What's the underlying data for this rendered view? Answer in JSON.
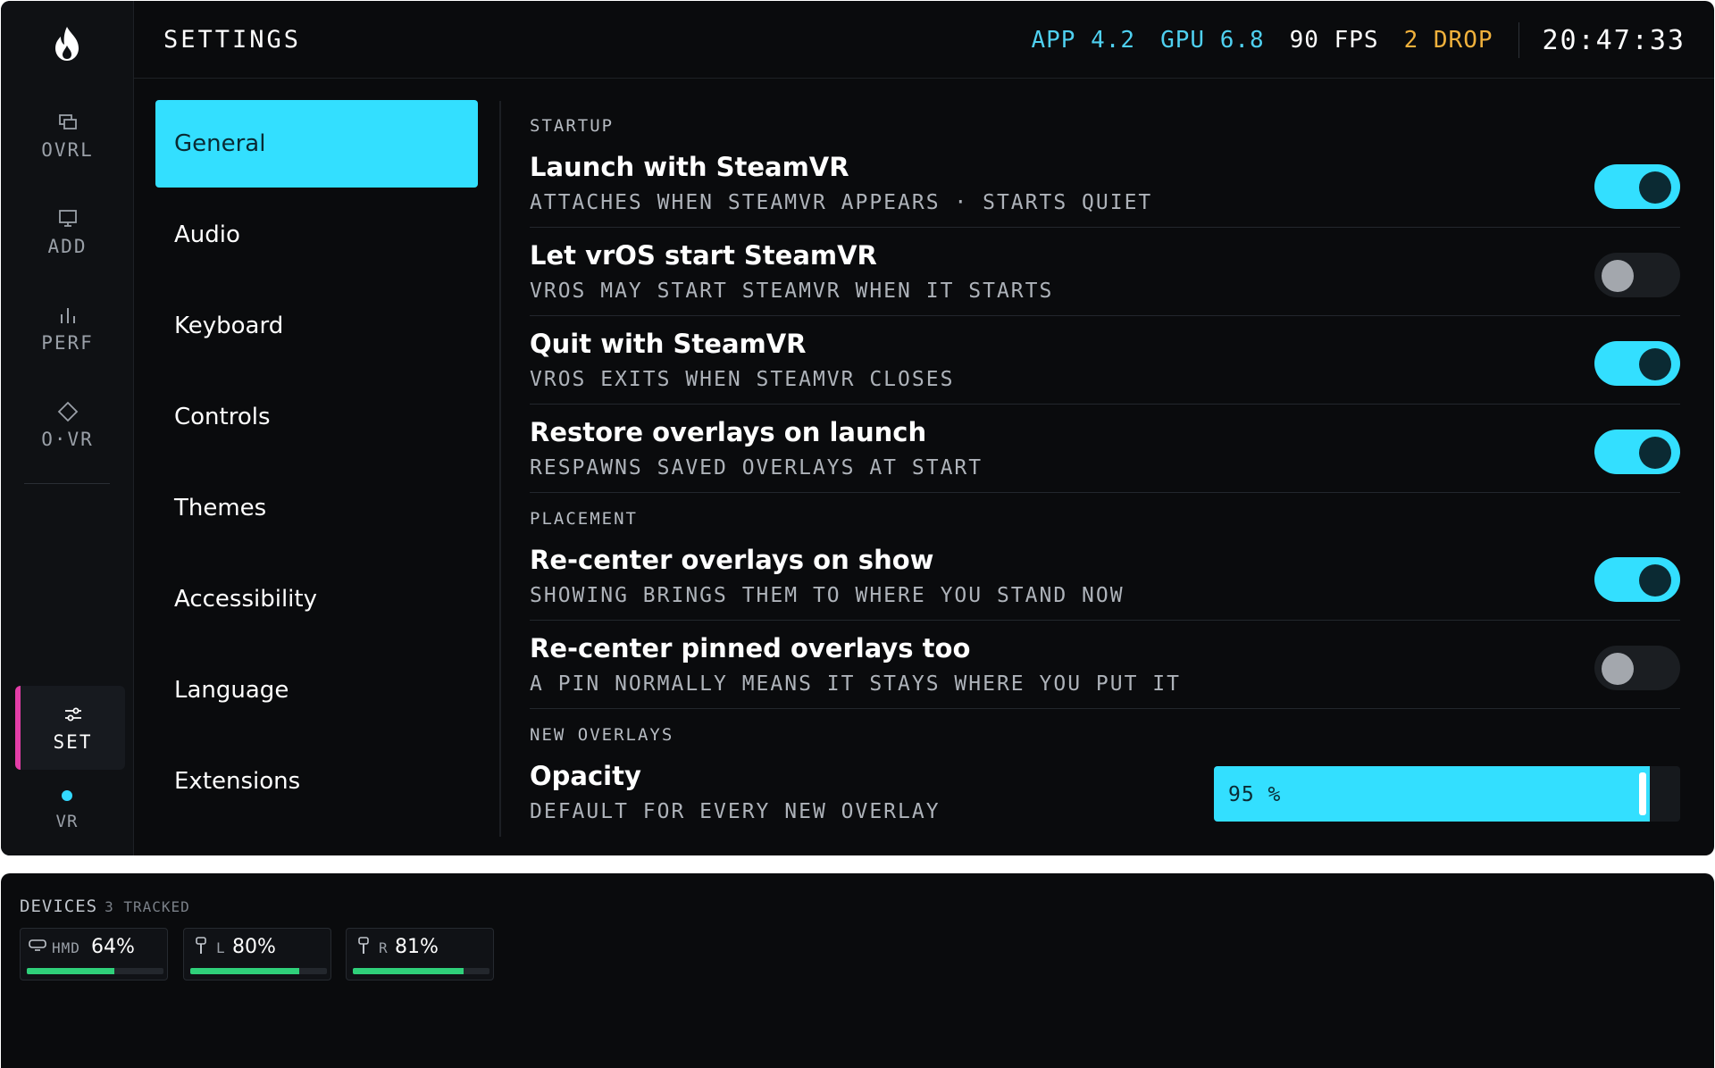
{
  "rail": {
    "items": [
      {
        "label": "OVRL",
        "icon": "overlays-icon"
      },
      {
        "label": "ADD",
        "icon": "monitor-icon"
      },
      {
        "label": "PERF",
        "icon": "bar-chart-icon"
      },
      {
        "label": "O·VR",
        "icon": "diamond-icon"
      }
    ],
    "active": {
      "label": "SET",
      "icon": "sliders-icon"
    },
    "status": {
      "label": "VR",
      "color": "#33d9ff"
    }
  },
  "topbar": {
    "title": "SETTINGS",
    "app": "APP 4.2",
    "gpu": "GPU 6.8",
    "fps": "90 FPS",
    "drop": "2 DROP",
    "clock": "20:47:33"
  },
  "categories": [
    "General",
    "Audio",
    "Keyboard",
    "Controls",
    "Themes",
    "Accessibility",
    "Language",
    "Extensions"
  ],
  "active_category": "General",
  "sections": {
    "startup": {
      "title": "STARTUP",
      "rows": [
        {
          "title": "Launch with SteamVR",
          "desc": "ATTACHES WHEN STEAMVR APPEARS · STARTS QUIET",
          "on": true
        },
        {
          "title": "Let vrOS start SteamVR",
          "desc": "VROS MAY START STEAMVR WHEN IT STARTS",
          "on": false
        },
        {
          "title": "Quit with SteamVR",
          "desc": "VROS EXITS WHEN STEAMVR CLOSES",
          "on": true
        },
        {
          "title": "Restore overlays on launch",
          "desc": "RESPAWNS SAVED OVERLAYS AT START",
          "on": true
        }
      ]
    },
    "placement": {
      "title": "PLACEMENT",
      "rows": [
        {
          "title": "Re-center overlays on show",
          "desc": "SHOWING BRINGS THEM TO WHERE YOU STAND NOW",
          "on": true
        },
        {
          "title": "Re-center pinned overlays too",
          "desc": "A PIN NORMALLY MEANS IT STAYS WHERE YOU PUT IT",
          "on": false
        }
      ]
    },
    "new_overlays": {
      "title": "NEW OVERLAYS",
      "opacity": {
        "title": "Opacity",
        "desc": "DEFAULT FOR EVERY NEW OVERLAY",
        "value": 95,
        "value_label": "95 %"
      }
    }
  },
  "devices": {
    "title": "DEVICES",
    "count": "3 TRACKED",
    "items": [
      {
        "name": "HMD",
        "pct": "64%",
        "level": 64,
        "icon": "headset-icon"
      },
      {
        "name": "L",
        "pct": "80%",
        "level": 80,
        "icon": "controller-left-icon"
      },
      {
        "name": "R",
        "pct": "81%",
        "level": 81,
        "icon": "controller-right-icon"
      }
    ]
  },
  "colors": {
    "accent": "#33dfff",
    "active_marker": "#e33ea8",
    "drop_warning": "#f0b13c",
    "battery": "#2fd07a"
  }
}
